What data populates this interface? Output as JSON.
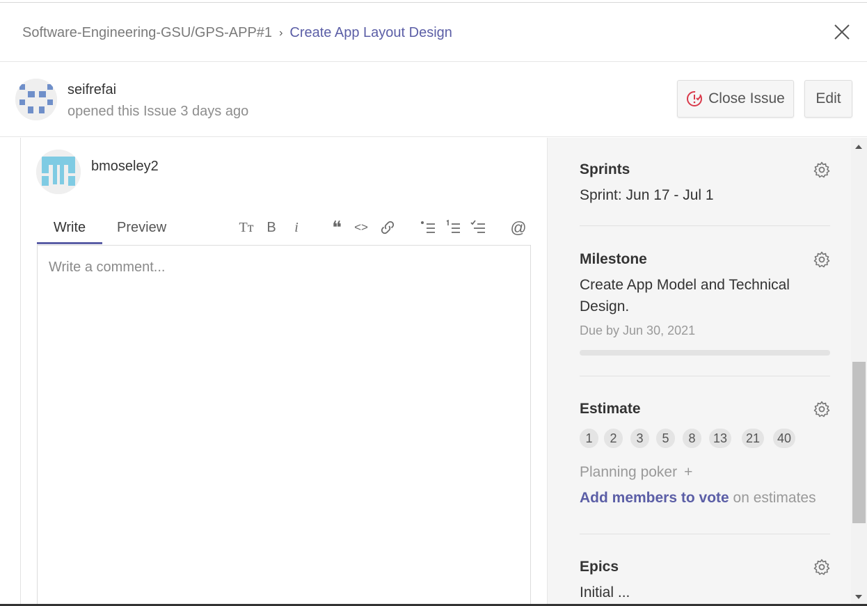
{
  "breadcrumb": {
    "repo": "Software-Engineering-GSU/GPS-APP#1",
    "separator": "›",
    "issue_title": "Create App Layout Design"
  },
  "opener": {
    "username": "seifrefai",
    "meta": "opened this Issue 3 days ago"
  },
  "actions": {
    "close_issue": "Close Issue",
    "edit": "Edit"
  },
  "comment": {
    "username": "bmoseley2",
    "tabs": [
      "Write",
      "Preview"
    ],
    "placeholder": "Write a comment...",
    "toolbar": {
      "text_size": "Tт",
      "bold": "B",
      "italic": "i",
      "quote": "❝",
      "code": "<>",
      "mention": "@"
    }
  },
  "sidebar": {
    "sprints": {
      "title": "Sprints",
      "value": "Sprint: Jun 17 - Jul 1"
    },
    "milestone": {
      "title": "Milestone",
      "value_line1": "Create App Model and Technical",
      "value_line2": "Design.",
      "due": "Due by Jun 30, 2021",
      "progress": 0
    },
    "estimate": {
      "title": "Estimate",
      "points": [
        "1",
        "2",
        "3",
        "5",
        "8",
        "13",
        "21",
        "40"
      ],
      "planning_poker": "Planning poker",
      "plus": "+",
      "add_members": "Add members to vote",
      "on_estimates": " on estimates"
    },
    "epics": {
      "title": "Epics",
      "value": "Initial ..."
    }
  },
  "colors": {
    "accent": "#5b5ea6",
    "close_icon_red": "#d9394a"
  }
}
